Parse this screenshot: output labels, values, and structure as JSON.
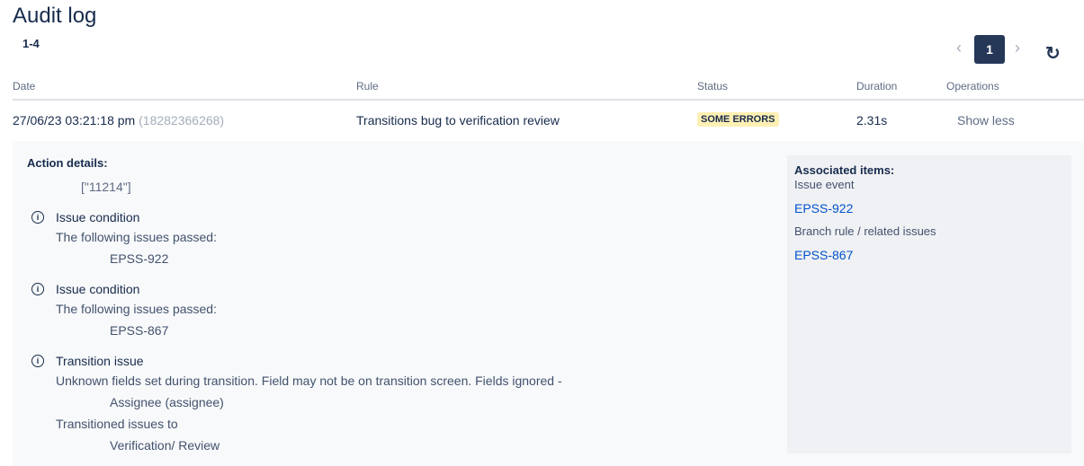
{
  "title": "Audit log",
  "range": "1-4",
  "pagination": {
    "prev": "‹",
    "current": "1",
    "next": "›"
  },
  "refresh_icon": "↻",
  "columns": [
    "Date",
    "Rule",
    "Status",
    "Duration",
    "Operations"
  ],
  "row": {
    "date": "27/06/23 03:21:18 pm",
    "id": "(18282366268)",
    "rule": "Transitions bug to verification review",
    "status": "SOME ERRORS",
    "duration": "2.31s",
    "operation": "Show less"
  },
  "details": {
    "heading": "Action details:",
    "value": "[\"11214\"]",
    "items": [
      {
        "title": "Issue condition",
        "text": "The following issues passed:",
        "sub": "EPSS-922"
      },
      {
        "title": "Issue condition",
        "text": "The following issues passed:",
        "sub": "EPSS-867"
      },
      {
        "title": "Transition issue",
        "text": "Unknown fields set during transition. Field may not be on transition screen. Fields ignored -",
        "sub": "Assignee (assignee)",
        "text2": "Transitioned issues to",
        "sub2": "Verification/ Review"
      }
    ]
  },
  "associated": {
    "heading": "Associated items:",
    "label1": "Issue event",
    "link1": "EPSS-922",
    "label2": "Branch rule / related issues",
    "link2": "EPSS-867"
  }
}
